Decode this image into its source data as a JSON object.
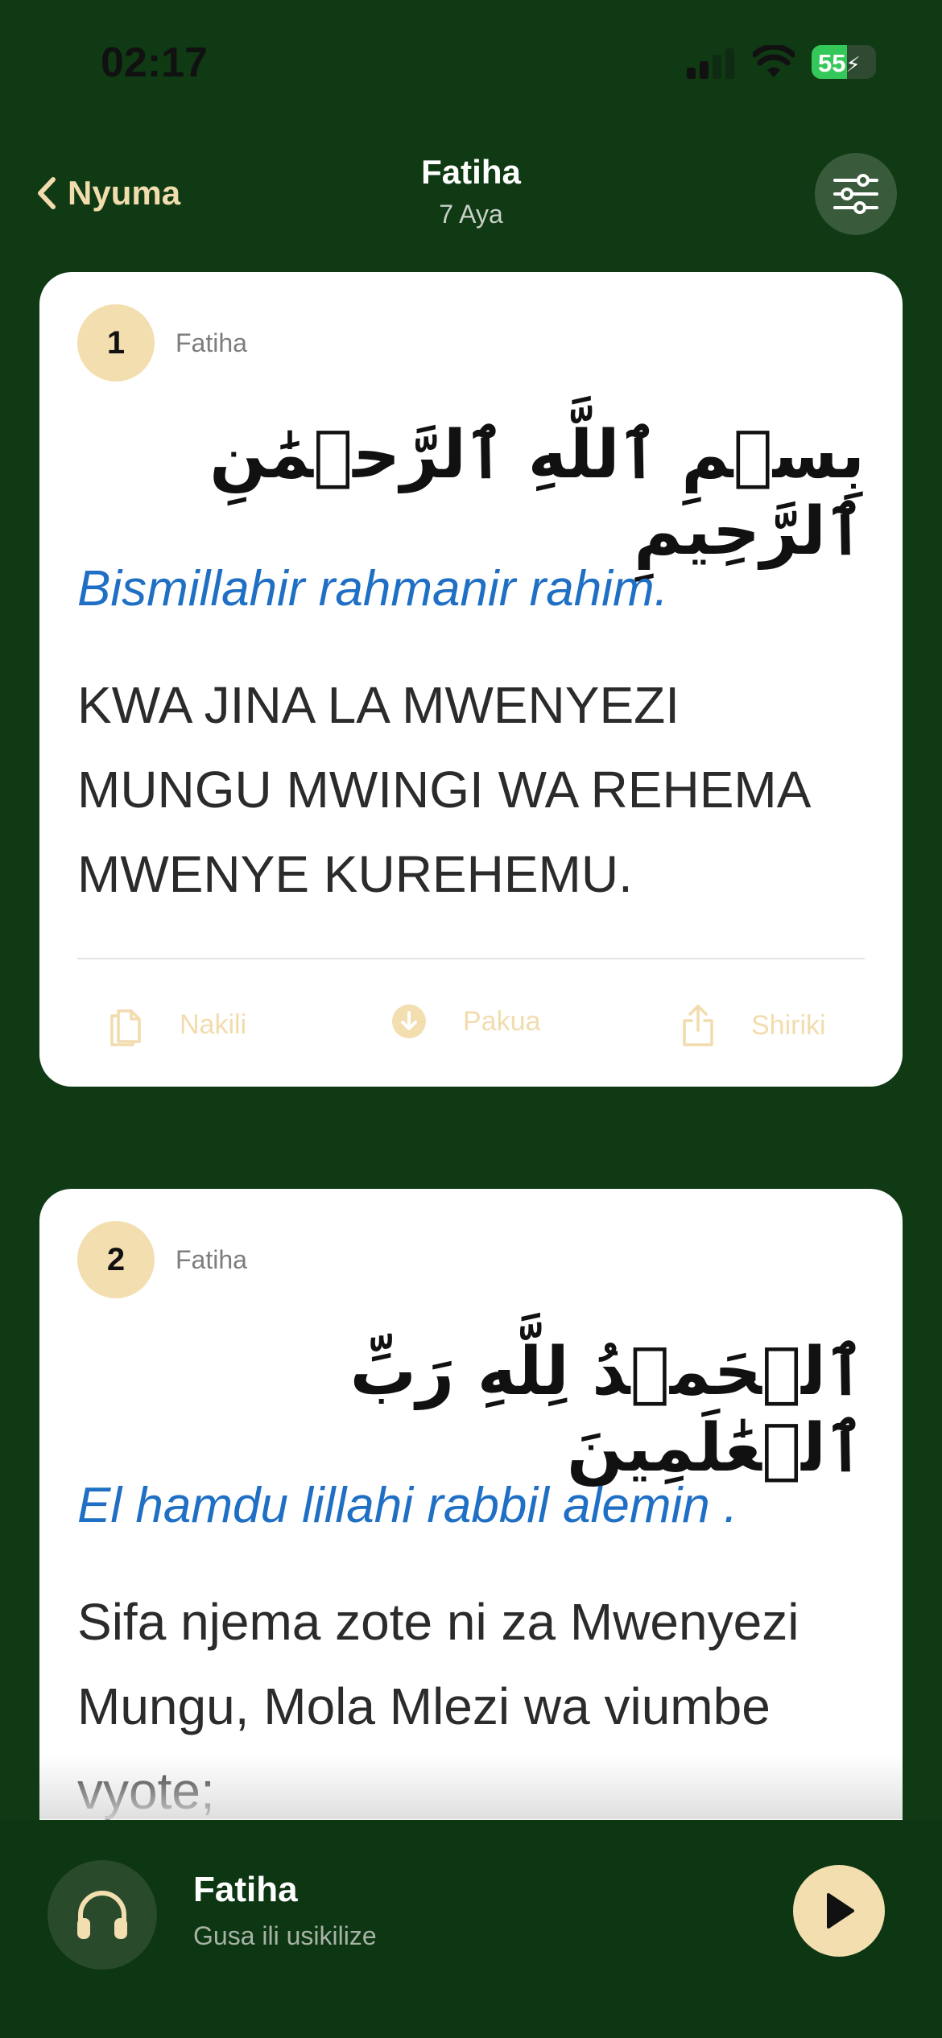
{
  "status": {
    "time": "02:17",
    "battery": "55"
  },
  "header": {
    "back_label": "Nyuma",
    "title": "Fatiha",
    "subtitle": "7 Aya"
  },
  "verses": [
    {
      "number": "1",
      "surah": "Fatiha",
      "arabic": "بِسۡمِ ٱللَّهِ ٱلرَّحۡمَٰنِ ٱلرَّحِيمِ",
      "transliteration": "Bismillahir rahmanir rahim.",
      "translation": "KWA JINA LA MWENYEZI MUNGU MWINGI WA REHEMA MWENYE KUREHEMU."
    },
    {
      "number": "2",
      "surah": "Fatiha",
      "arabic": "ٱلۡحَمۡدُ لِلَّهِ رَبِّ ٱلۡعَٰلَمِينَ",
      "transliteration": "El hamdu lillahi rabbil alemin .",
      "translation": "Sifa njema zote ni za Mwenyezi Mungu, Mola Mlezi wa viumbe vyote;"
    }
  ],
  "actions": {
    "copy": "Nakili",
    "download": "Pakua",
    "share": "Shiriki"
  },
  "player": {
    "title": "Fatiha",
    "subtitle": "Gusa ili usikilize"
  },
  "colors": {
    "background": "#0f3a14",
    "accent": "#f3deb0",
    "transliteration": "#1f6fc4"
  },
  "icons": [
    "chevron-left-icon",
    "sliders-icon",
    "copy-icon",
    "download-icon",
    "share-icon",
    "headphones-icon",
    "play-icon"
  ]
}
